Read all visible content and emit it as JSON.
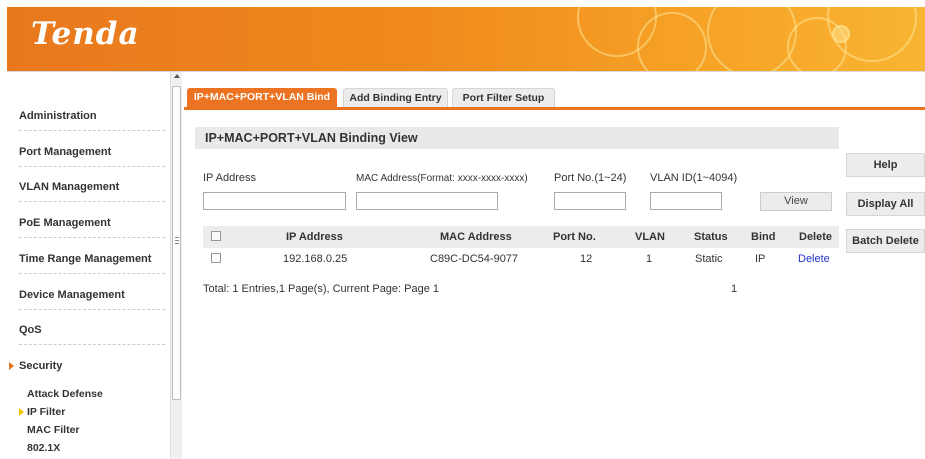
{
  "header": {
    "logo": "Tenda",
    "brand_color": "#ec7321"
  },
  "sidebar": {
    "items": [
      {
        "label": "Administration"
      },
      {
        "label": "Port Management"
      },
      {
        "label": "VLAN Management"
      },
      {
        "label": "PoE Management"
      },
      {
        "label": "Time Range Management"
      },
      {
        "label": "Device Management"
      },
      {
        "label": "QoS"
      },
      {
        "label": "Security"
      }
    ],
    "sub_items": [
      {
        "label": "Attack Defense"
      },
      {
        "label": "IP Filter"
      },
      {
        "label": "MAC Filter"
      },
      {
        "label": "802.1X"
      }
    ]
  },
  "tabs": [
    {
      "label": "IP+MAC+PORT+VLAN Bind",
      "active": true
    },
    {
      "label": "Add Binding Entry",
      "active": false
    },
    {
      "label": "Port Filter Setup",
      "active": false
    }
  ],
  "main": {
    "section_title": "IP+MAC+PORT+VLAN Binding View",
    "fields": {
      "ip_label": "IP Address",
      "mac_label": "MAC Address(Format: xxxx-xxxx-xxxx)",
      "port_label": "Port No.(1~24)",
      "vlan_label": "VLAN ID(1~4094)",
      "ip_value": "",
      "mac_value": "",
      "port_value": "",
      "vlan_value": ""
    },
    "view_button": "View",
    "table": {
      "columns": [
        "IP Address",
        "MAC Address",
        "Port No.",
        "VLAN",
        "Status",
        "Bind",
        "Delete"
      ],
      "rows": [
        {
          "ip": "192.168.0.25",
          "mac": "C89C-DC54-9077",
          "port": "12",
          "vlan": "1",
          "status": "Static",
          "bind": "IP",
          "delete": "Delete"
        }
      ]
    },
    "footer": "Total: 1 Entries,1 Page(s), Current Page: Page 1",
    "page_number": "1"
  },
  "side_buttons": {
    "help": "Help",
    "display_all": "Display All",
    "batch_delete": "Batch Delete"
  }
}
